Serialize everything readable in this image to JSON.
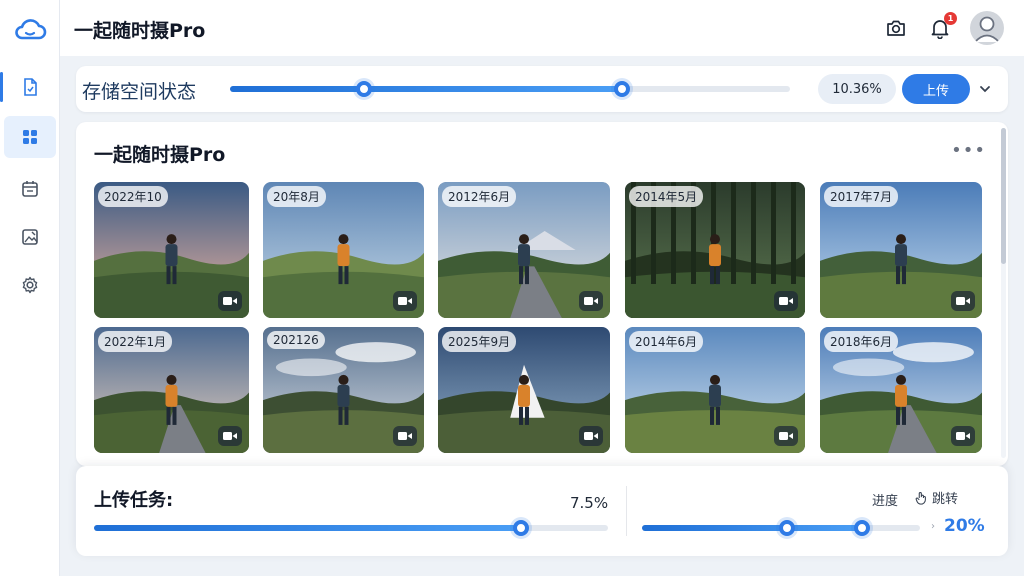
{
  "app": {
    "title": "一起随时摄Pro"
  },
  "header": {
    "notification_count": "1"
  },
  "sidebar": {
    "items": [
      {
        "icon": "file-icon",
        "active": false
      },
      {
        "icon": "grid-icon",
        "active": true
      },
      {
        "icon": "calendar-icon",
        "active": false
      },
      {
        "icon": "image-edit-icon",
        "active": false
      },
      {
        "icon": "gear-icon",
        "active": false
      }
    ]
  },
  "storage": {
    "title": "存储空间状态",
    "range_start": 0.24,
    "range_end": 0.7,
    "percent_label": "10.36%",
    "upload_label": "上传",
    "dropdown_icon": "chevron-down-icon"
  },
  "gallery": {
    "title": "一起随时摄Pro",
    "more_label": "•••",
    "photos": [
      {
        "date": "2022年10",
        "scene": "dusk"
      },
      {
        "date": "20年8月",
        "scene": "hills"
      },
      {
        "date": "2012年6月",
        "scene": "road-mountain"
      },
      {
        "date": "2014年5月",
        "scene": "forest"
      },
      {
        "date": "2017年7月",
        "scene": "meadow"
      },
      {
        "date": "2022年1月",
        "scene": "girl-path"
      },
      {
        "date": "202126",
        "scene": "clouds"
      },
      {
        "date": "2025年9月",
        "scene": "tent"
      },
      {
        "date": "2014年6月",
        "scene": "grass-sky"
      },
      {
        "date": "2018年6月",
        "scene": "valley-road"
      }
    ]
  },
  "tasks": {
    "title": "上传任务:",
    "percent": "7.5%",
    "left_progress": 0.83,
    "speed_label": "进度",
    "link_label": "跳转",
    "right_range_start": 0.52,
    "right_range_end": 0.79,
    "right_percent": "20%"
  },
  "colors": {
    "accent": "#2f7be6",
    "background": "#eef2f7"
  }
}
